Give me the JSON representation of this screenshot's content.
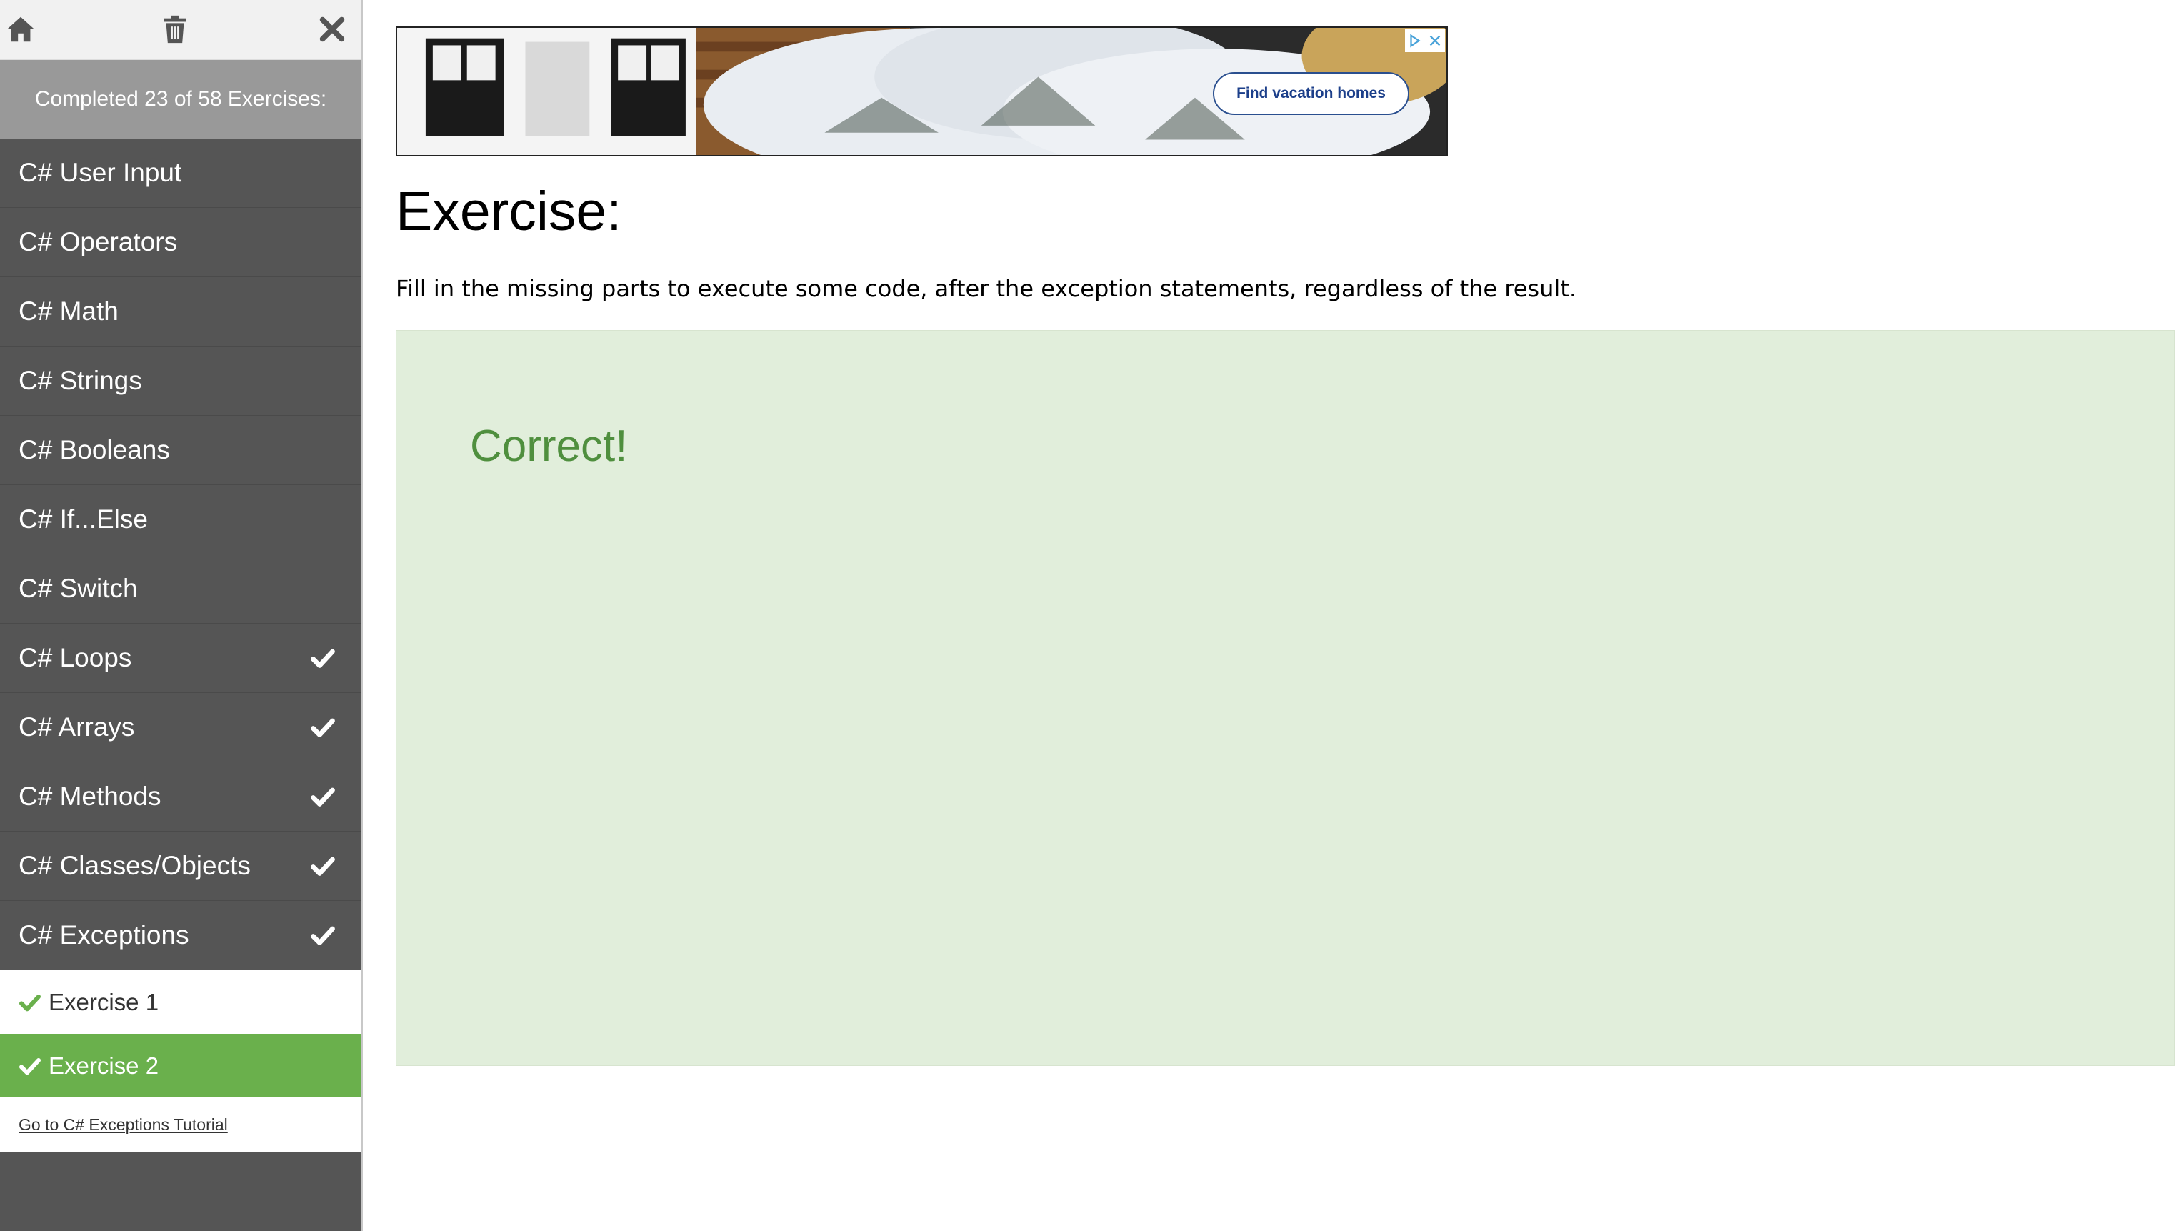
{
  "sidebar": {
    "top_icons": [
      "home-icon",
      "trash-icon",
      "close-icon"
    ],
    "progress_text": "Completed 23 of 58 Exercises:",
    "items": [
      {
        "label": "C# User Input",
        "completed": false
      },
      {
        "label": "C# Operators",
        "completed": false
      },
      {
        "label": "C# Math",
        "completed": false
      },
      {
        "label": "C# Strings",
        "completed": false
      },
      {
        "label": "C# Booleans",
        "completed": false
      },
      {
        "label": "C# If...Else",
        "completed": false
      },
      {
        "label": "C# Switch",
        "completed": false
      },
      {
        "label": "C# Loops",
        "completed": true
      },
      {
        "label": "C# Arrays",
        "completed": true
      },
      {
        "label": "C# Methods",
        "completed": true
      },
      {
        "label": "C# Classes/Objects",
        "completed": true
      },
      {
        "label": "C# Exceptions",
        "completed": true,
        "expanded": true
      }
    ],
    "sub_items": [
      {
        "label": "Exercise 1",
        "completed": true,
        "active": false
      },
      {
        "label": "Exercise 2",
        "completed": true,
        "active": true
      }
    ],
    "tutorial_link": "Go to C# Exceptions Tutorial"
  },
  "ad": {
    "cta_label": "Find vacation homes"
  },
  "main": {
    "title": "Exercise:",
    "description": "Fill in the missing parts to execute some code, after the exception statements, regardless of the result.",
    "result": "Correct!"
  },
  "colors": {
    "sidebar_bg": "#555555",
    "progress_bg": "#999999",
    "active_exercise_bg": "#6ab04c",
    "result_bg": "#e1eedb",
    "result_text": "#4f8f3e"
  }
}
